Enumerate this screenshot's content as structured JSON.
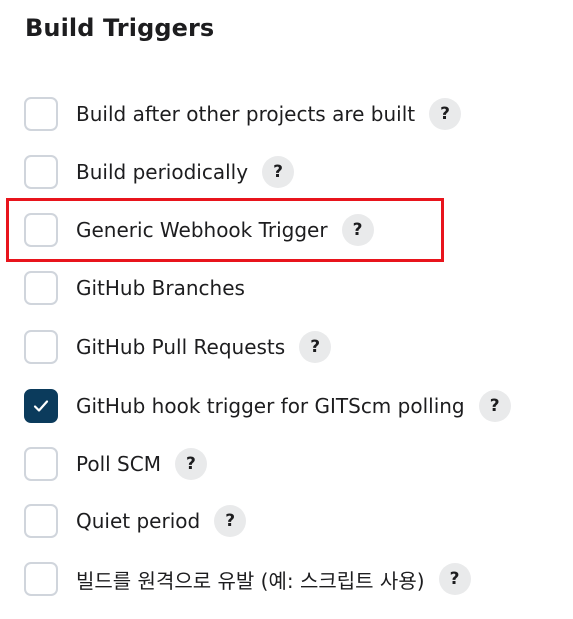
{
  "section": {
    "title": "Build Triggers"
  },
  "triggers": [
    {
      "label": "Build after other projects are built",
      "checked": false,
      "help": "?"
    },
    {
      "label": "Build periodically",
      "checked": false,
      "help": "?"
    },
    {
      "label": "Generic Webhook Trigger",
      "checked": false,
      "help": "?"
    },
    {
      "label": "GitHub Branches",
      "checked": false
    },
    {
      "label": "GitHub Pull Requests",
      "checked": false,
      "help": "?"
    },
    {
      "label": "GitHub hook trigger for GITScm polling",
      "checked": true,
      "help": "?"
    },
    {
      "label": "Poll SCM",
      "checked": false,
      "help": "?"
    },
    {
      "label": "Quiet period",
      "checked": false,
      "help": "?"
    },
    {
      "label": "빌드를 원격으로 유발 (예: 스크립트 사용)",
      "checked": false,
      "help": "?"
    }
  ],
  "colors": {
    "checked_fill": "#0b3b5c",
    "unchecked_border": "#d0d5dc",
    "help_bg": "#e9eaeb",
    "highlight": "#e8141c"
  },
  "icons": {
    "check": "check-icon",
    "help": "question-mark-icon"
  }
}
